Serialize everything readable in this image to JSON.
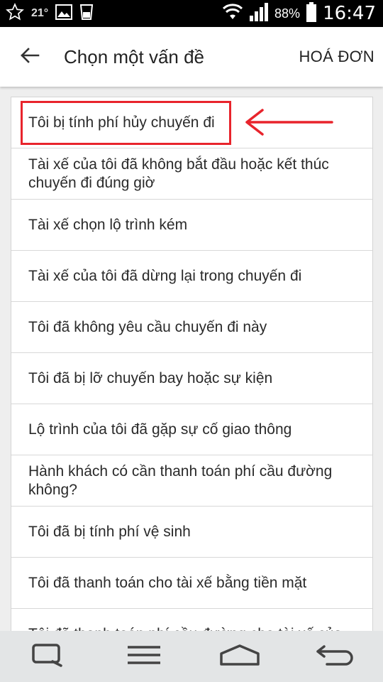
{
  "status_bar": {
    "temperature": "21°",
    "battery": "88%",
    "time": "16:47"
  },
  "app_bar": {
    "title": "Chọn một vấn đề",
    "action_label": "HOÁ ĐƠN"
  },
  "issues": [
    "Tôi bị tính phí hủy chuyến đi",
    "Tài xế của tôi đã không bắt đầu hoặc kết thúc chuyến đi đúng giờ",
    "Tài xế chọn lộ trình kém",
    " Tài xế của tôi đã dừng lại trong chuyến đi",
    "Tôi đã không yêu cầu chuyến đi này",
    "Tôi đã bị lỡ chuyến bay hoặc sự kiện",
    "Lộ trình của tôi đã gặp sự cố giao thông",
    "Hành khách có cần thanh toán phí cầu đường không?",
    "Tôi đã bị tính phí vệ sinh",
    "Tôi đã thanh toán cho tài xế bằng tiền mặt",
    "Tôi đã thanh toán phí cầu đường cho tài xế của"
  ],
  "annotation": {
    "highlight_color": "#e8242c"
  },
  "nav_icons": [
    "recent-apps-icon",
    "menu-icon",
    "home-icon",
    "back-icon"
  ]
}
